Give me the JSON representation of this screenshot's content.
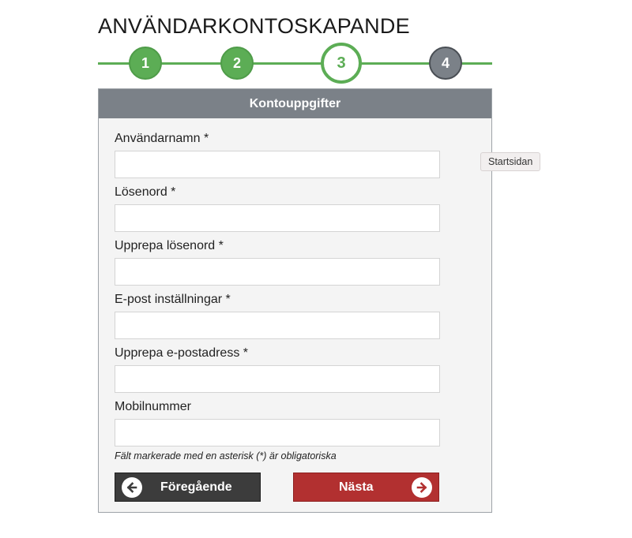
{
  "page": {
    "title": "ANVÄNDARKONTOSKAPANDE"
  },
  "stepper": {
    "steps": [
      {
        "label": "1",
        "state": "done"
      },
      {
        "label": "2",
        "state": "done"
      },
      {
        "label": "3",
        "state": "current"
      },
      {
        "label": "4",
        "state": "todo"
      }
    ],
    "colors": {
      "done": "#5cad55",
      "todo": "#7b8188"
    }
  },
  "form": {
    "header": "Kontouppgifter",
    "fields": [
      {
        "label": "Användarnamn *",
        "value": "",
        "placeholder": ""
      },
      {
        "label": "Lösenord *",
        "value": "",
        "placeholder": ""
      },
      {
        "label": "Upprepa lösenord *",
        "value": "",
        "placeholder": ""
      },
      {
        "label": "E-post inställningar *",
        "value": "",
        "placeholder": ""
      },
      {
        "label": "Upprepa e-postadress *",
        "value": "",
        "placeholder": ""
      },
      {
        "label": "Mobilnummer",
        "value": "",
        "placeholder": ""
      }
    ],
    "required_note": "Fält markerade med en asterisk (*) är obligatoriska",
    "buttons": {
      "previous": {
        "label": "Föregående",
        "icon": "arrow-left-icon",
        "color": "#3c3c3c"
      },
      "next": {
        "label": "Nästa",
        "icon": "arrow-right-icon",
        "color": "#b23030"
      }
    }
  },
  "tooltip": {
    "text": "Startsidan"
  }
}
